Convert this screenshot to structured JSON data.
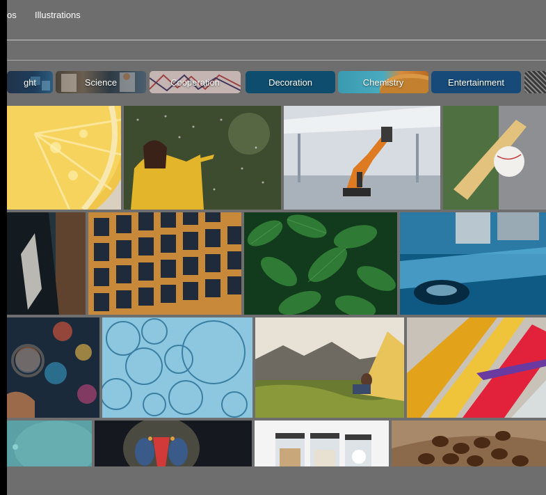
{
  "nav": {
    "tabs": [
      {
        "label": "os"
      },
      {
        "label": "Illustrations"
      }
    ]
  },
  "categories": [
    {
      "label": "ght"
    },
    {
      "label": "Science"
    },
    {
      "label": "Cooperation"
    },
    {
      "label": "Decoration"
    },
    {
      "label": "Chemistry"
    },
    {
      "label": "Entertainment"
    },
    {
      "label": ""
    }
  ],
  "photos": [
    {
      "subject": "lemon-slice"
    },
    {
      "subject": "woman-in-rain"
    },
    {
      "subject": "robot-factory"
    },
    {
      "subject": "baseball-bat"
    },
    {
      "subject": "person-dark"
    },
    {
      "subject": "building-facade"
    },
    {
      "subject": "green-leaves"
    },
    {
      "subject": "microscope"
    },
    {
      "subject": "city-lights-magnifier"
    },
    {
      "subject": "soap-bubbles"
    },
    {
      "subject": "tent-mountains"
    },
    {
      "subject": "colorful-liquids"
    },
    {
      "subject": "teal-blur"
    },
    {
      "subject": "mandrill"
    },
    {
      "subject": "jars-cotton"
    },
    {
      "subject": "coffee-beans"
    }
  ]
}
